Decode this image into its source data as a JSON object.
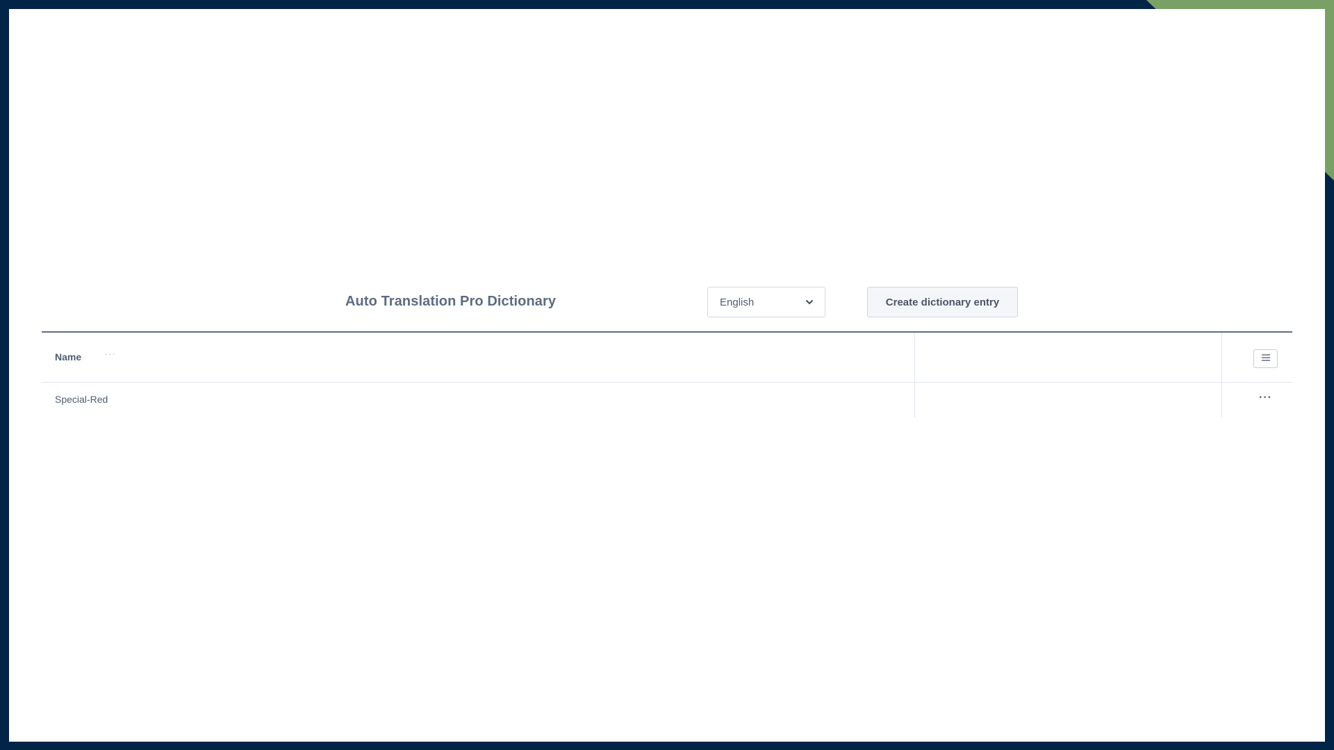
{
  "page": {
    "title": "Auto Translation Pro Dictionary"
  },
  "toolbar": {
    "language_select": {
      "selected": "English",
      "icon": "chevron-down-icon"
    },
    "create_button_label": "Create dictionary entry"
  },
  "grid": {
    "columns": [
      {
        "label": "Name",
        "menu_icon": "ellipsis-icon"
      },
      {
        "label": ""
      }
    ],
    "settings_icon": "list-icon",
    "rows": [
      {
        "name": "Special-Red",
        "value": "",
        "actions_icon": "ellipsis-icon"
      }
    ]
  },
  "colors": {
    "frame": "#022447",
    "accent": "#7ba065",
    "text": "#4f5d70"
  }
}
